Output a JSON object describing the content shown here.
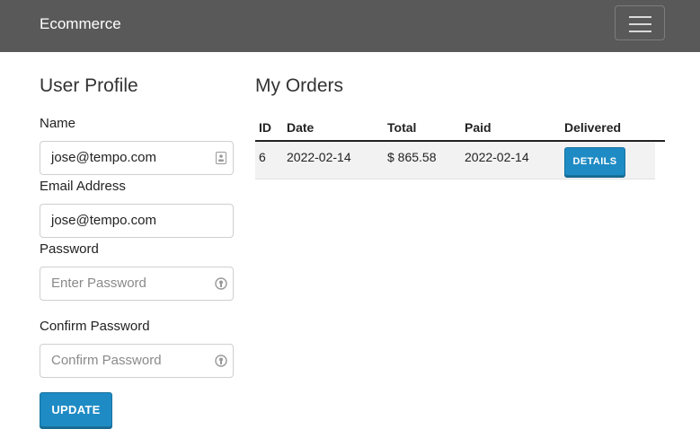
{
  "navbar": {
    "brand": "Ecommerce",
    "toggler_icon": "hamburger-icon"
  },
  "profile": {
    "title": "User Profile",
    "name_label": "Name",
    "name_value": "jose@tempo.com",
    "email_label": "Email Address",
    "email_value": "jose@tempo.com",
    "password_label": "Password",
    "password_placeholder": "Enter Password",
    "confirm_label": "Confirm Password",
    "confirm_placeholder": "Confirm Password",
    "update_label": "Update"
  },
  "orders": {
    "title": "My Orders",
    "columns": [
      "ID",
      "Date",
      "Total",
      "Paid",
      "Delivered"
    ],
    "rows": [
      {
        "id": "6",
        "date": "2022-02-14",
        "total": "$ 865.58",
        "paid": "2022-02-14",
        "details_label": "Details"
      }
    ]
  },
  "colors": {
    "navbar": "#595959",
    "accent": "#1f8bc4"
  }
}
